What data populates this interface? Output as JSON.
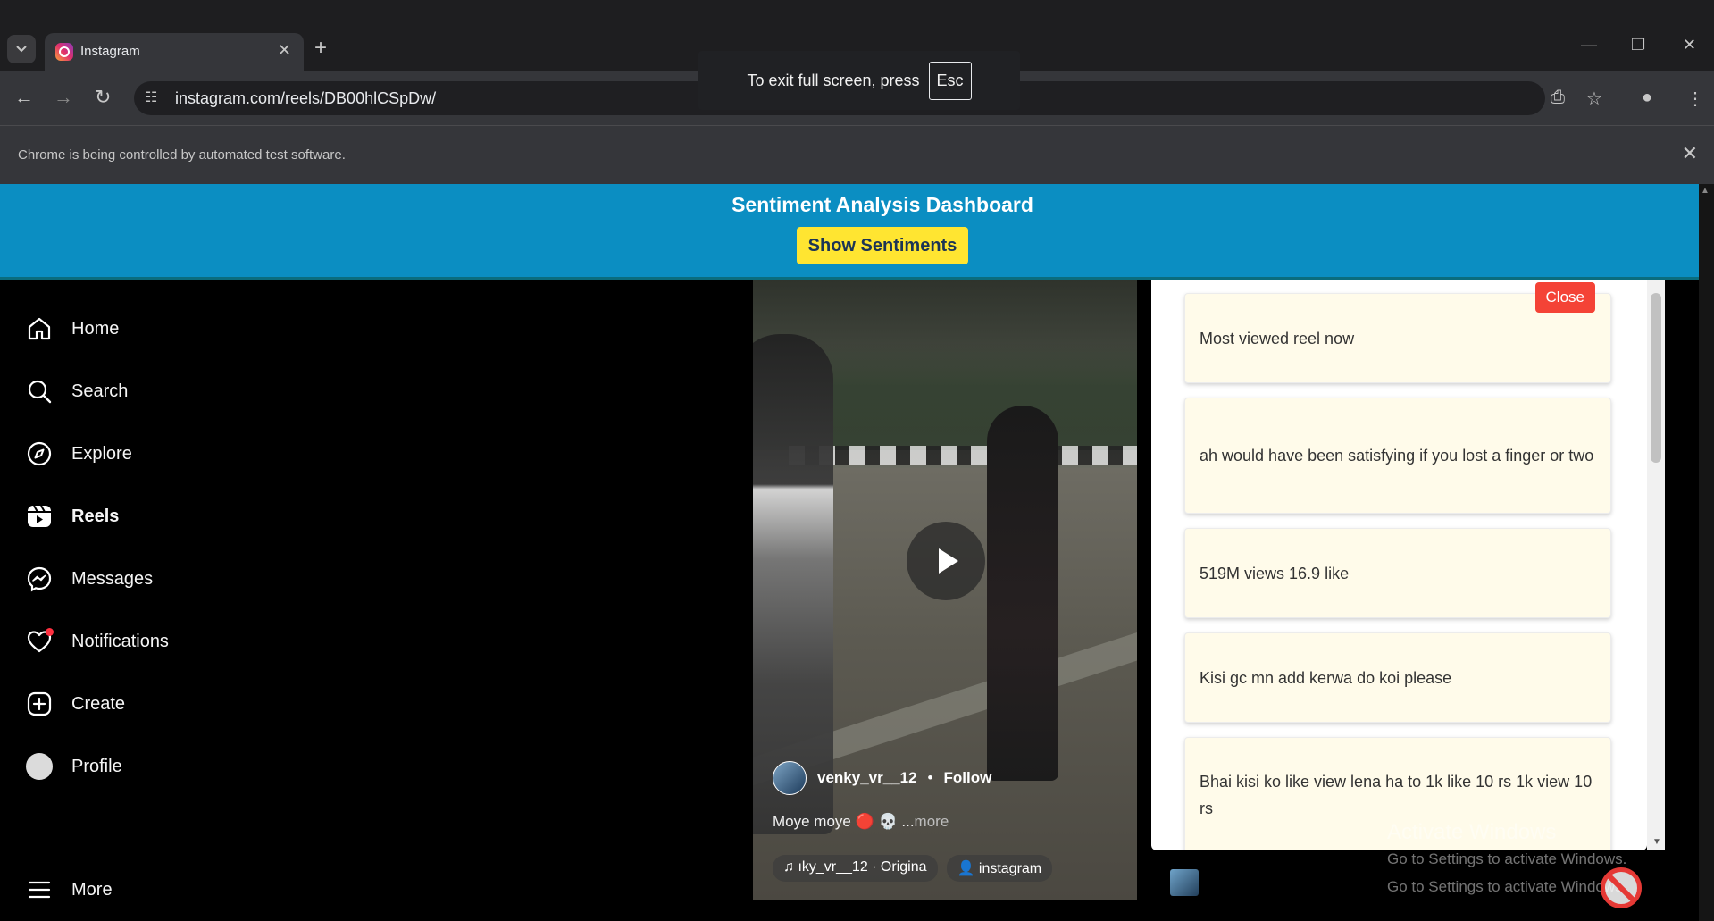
{
  "browser": {
    "tab_title": "Instagram",
    "tab_close": "✕",
    "new_tab": "+",
    "url": "instagram.com/reels/DB00hlCSpDw/",
    "fullscreen_toast": {
      "text": "To exit full screen, press",
      "key": "Esc"
    },
    "infobar_text": "Chrome is being controlled by automated test software.",
    "infobar_close": "✕",
    "icons": [
      "tab-search-icon",
      "back-icon",
      "forward-icon",
      "reload-icon",
      "site-info-icon",
      "install-app-icon",
      "bookmark-star-icon",
      "profile-icon",
      "menu-icon",
      "minimize-icon",
      "restore-icon",
      "close-icon"
    ]
  },
  "dashboard": {
    "title": "Sentiment Analysis Dashboard",
    "button_label": "Show Sentiments",
    "banner_color": "#0b8ec2",
    "button_color": "#ffe531"
  },
  "sidebar": {
    "items": [
      {
        "label": "Home",
        "icon": "home-icon"
      },
      {
        "label": "Search",
        "icon": "search-icon"
      },
      {
        "label": "Explore",
        "icon": "explore-compass-icon"
      },
      {
        "label": "Reels",
        "icon": "reels-icon",
        "active": true
      },
      {
        "label": "Messages",
        "icon": "messenger-icon"
      },
      {
        "label": "Notifications",
        "icon": "heart-icon"
      },
      {
        "label": "Create",
        "icon": "create-plus-icon"
      },
      {
        "label": "Profile",
        "icon": "profile-avatar-icon"
      }
    ],
    "more_label": "More"
  },
  "reel": {
    "username": "venky_vr__12",
    "separator": "•",
    "follow_label": "Follow",
    "caption": "Moye moye 🔴 💀 ...",
    "more_label": "more",
    "audio": "♫ ıky_vr__12 · Origina",
    "collab": "👤 instagram"
  },
  "panel": {
    "close_label": "Close",
    "comments": [
      "Most viewed reel now",
      "ah would have been satisfying if you lost a finger or two",
      "519M views 16.9 like",
      "Kisi gc mn add kerwa do koi please",
      "Bhai kisi ko like view lena ha to 1k like 10 rs 1k view 10 rs"
    ]
  },
  "watermark": {
    "line1": "Activate Windows",
    "line2": "Go to Settings to activate Windows.",
    "line3": "Go to Settings to activate Windows."
  }
}
